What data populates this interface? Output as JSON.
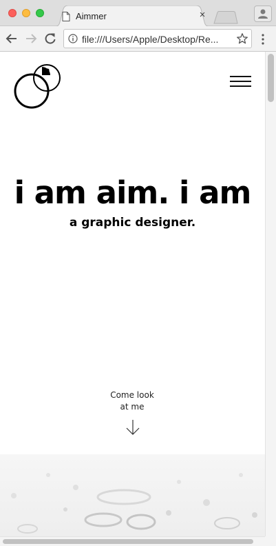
{
  "browser": {
    "tab_title": "Aimmer",
    "url": "file:///Users/Apple/Desktop/Re...",
    "icons": {
      "close_tab": "close-icon",
      "back": "back-arrow-icon",
      "forward": "forward-arrow-icon",
      "reload": "reload-icon",
      "info": "info-icon",
      "bookmark": "star-icon",
      "menu": "kebab-menu-icon",
      "profile": "person-icon",
      "page": "document-icon"
    },
    "traffic_colors": {
      "close": "#fc605c",
      "minimize": "#fdbc40",
      "maximize": "#34c84a"
    },
    "tab_close_glyph": "×"
  },
  "page": {
    "hero": {
      "headline": "i am aim. i am",
      "subheadline": "a graphic designer."
    },
    "cta": {
      "line1": "Come look",
      "line2": "at me"
    },
    "icons": {
      "logo": "circles-logo-icon",
      "menu": "hamburger-menu-icon",
      "cta_arrow": "arrow-down-icon"
    }
  }
}
